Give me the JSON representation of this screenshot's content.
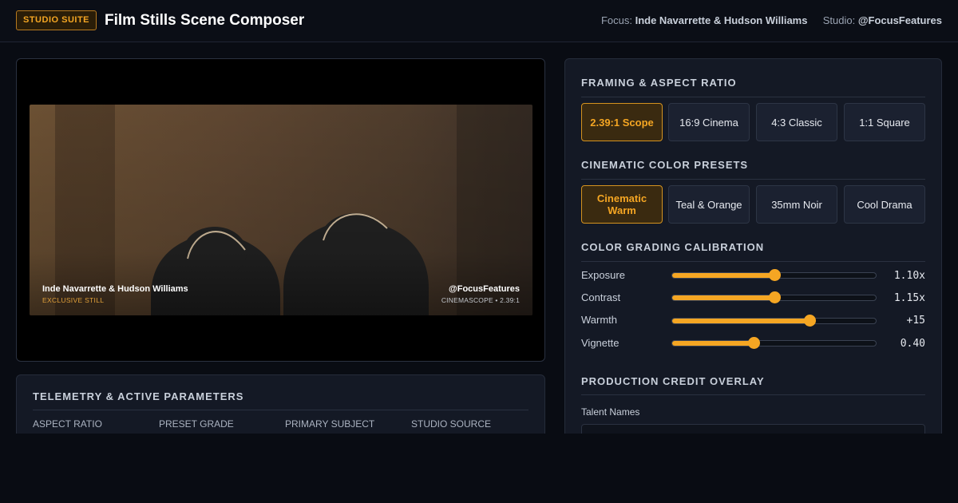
{
  "header": {
    "badge": "STUDIO SUITE",
    "title": "Film Stills Scene Composer",
    "focus_label": "Focus:",
    "focus_value": "Inde Navarrette & Hudson Williams",
    "studio_label": "Studio:",
    "studio_value": "@FocusFeatures"
  },
  "preview": {
    "caption_name": "Inde Navarrette & Hudson Williams",
    "caption_tag": "EXCLUSIVE STILL",
    "caption_studio": "@FocusFeatures",
    "caption_format": "CINEMASCOPE • 2.39:1"
  },
  "telemetry": {
    "title": "TELEMETRY & ACTIVE PARAMETERS",
    "columns": [
      "ASPECT RATIO",
      "PRESET GRADE",
      "PRIMARY SUBJECT",
      "STUDIO SOURCE"
    ]
  },
  "framing": {
    "title": "FRAMING & ASPECT RATIO",
    "options": [
      "2.39:1 Scope",
      "16:9 Cinema",
      "4:3 Classic",
      "1:1 Square"
    ],
    "active": "2.39:1 Scope"
  },
  "presets": {
    "title": "CINEMATIC COLOR PRESETS",
    "options": [
      "Cinematic Warm",
      "Teal & Orange",
      "35mm Noir",
      "Cool Drama"
    ],
    "active": "Cinematic Warm"
  },
  "grading": {
    "title": "COLOR GRADING CALIBRATION",
    "sliders": [
      {
        "label": "Exposure",
        "value": "1.10x",
        "level": 0.5
      },
      {
        "label": "Contrast",
        "value": "1.15x",
        "level": 0.5
      },
      {
        "label": "Warmth",
        "value": "+15",
        "level": 0.675
      },
      {
        "label": "Vignette",
        "value": "0.40",
        "level": 0.4
      }
    ]
  },
  "credit": {
    "title": "PRODUCTION CREDIT OVERLAY",
    "talent_label": "Talent Names"
  },
  "colors": {
    "accent": "#f5a623",
    "background": "#090c13",
    "panel": "#141925"
  }
}
